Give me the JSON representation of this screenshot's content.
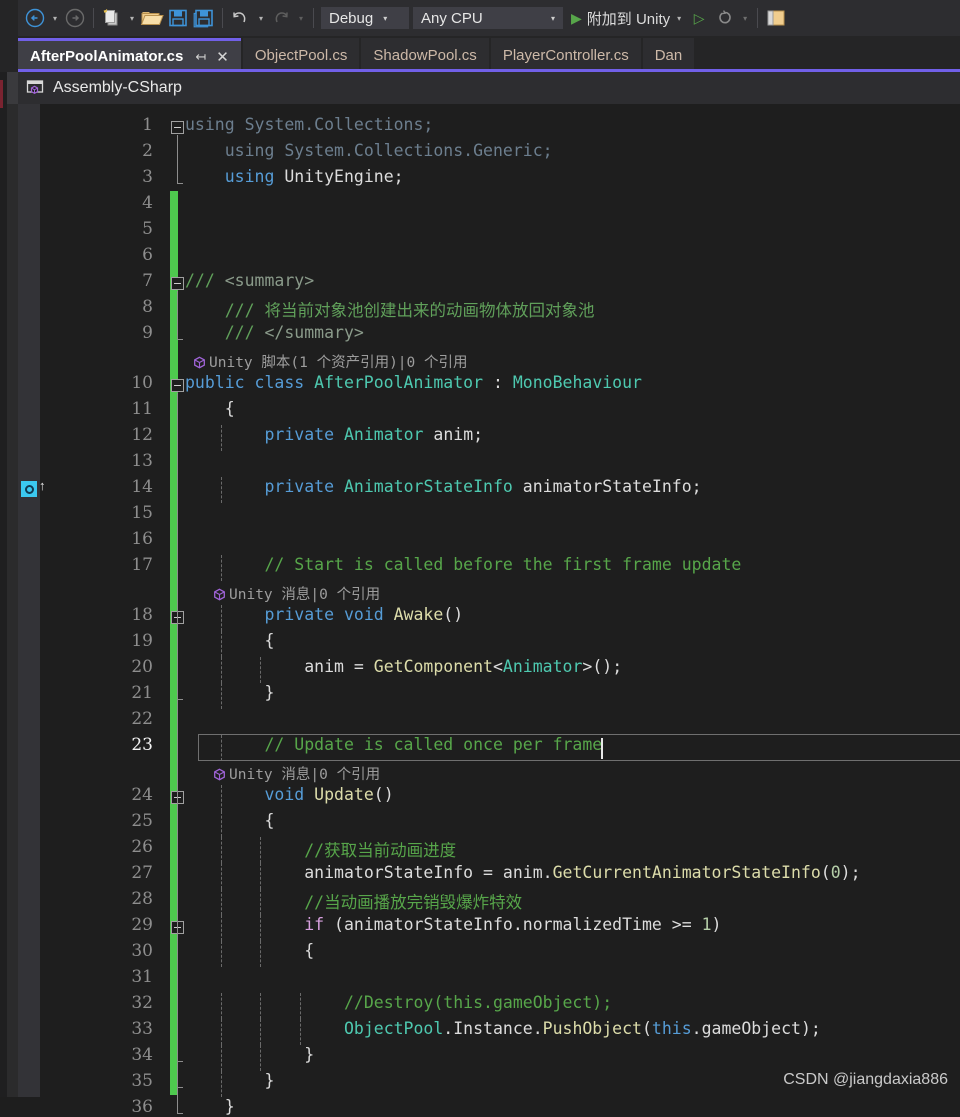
{
  "theme": {
    "bg": "#1e1e1e",
    "chrome": "#2d2d30",
    "accent_purple": "#7160e8",
    "change_bar_green": "#4ec94e",
    "keyword_blue": "#569cd6",
    "type_teal": "#4ec9b0",
    "comment_green": "#57a64a",
    "method_yellow": "#dcdcaa",
    "control_purple": "#d8a0df",
    "unity_marker_cyan": "#3bc9f0"
  },
  "toolbar": {
    "back_icon": "back-arrow-icon",
    "forward_icon": "forward-arrow-icon",
    "new_item_icon": "new-item-icon",
    "open_folder_icon": "open-folder-icon",
    "save_icon": "save-icon",
    "save_all_icon": "save-all-icon",
    "undo_icon": "undo-icon",
    "redo_icon": "redo-icon",
    "configuration": {
      "value": "Debug",
      "caret": "▾"
    },
    "platform": {
      "value": "Any CPU",
      "caret": "▾"
    },
    "run": {
      "play_glyph": "▶",
      "label": "附加到 Unity",
      "caret": "▾"
    },
    "run_alt_glyph": "▷",
    "hotreload_icon": "hot-reload-icon",
    "trailing_icon": "panel-icon"
  },
  "tabs": [
    {
      "label": "AfterPoolAnimator.cs",
      "active": true,
      "pin": "↤",
      "close": "✕"
    },
    {
      "label": "ObjectPool.cs",
      "active": false
    },
    {
      "label": "ShadowPool.cs",
      "active": false
    },
    {
      "label": "PlayerController.cs",
      "active": false
    },
    {
      "label": "Dan",
      "active": false
    }
  ],
  "breadcrumb": {
    "icon": "assembly-icon",
    "text": "Assembly-CSharp"
  },
  "editor": {
    "current_line": 23,
    "gutter_marker": {
      "icon": "unity-message-marker-icon",
      "arrow": "↑",
      "line": 10
    },
    "codelens": [
      {
        "after_line": 9,
        "icon": "unity-cube-icon",
        "text": "Unity 脚本(1 个资产引用)|0 个引用"
      },
      {
        "after_line": 17,
        "icon": "unity-cube-icon",
        "text": "Unity 消息|0 个引用"
      },
      {
        "after_line": 23,
        "icon": "unity-cube-icon",
        "text": "Unity 消息|0 个引用"
      }
    ],
    "lines": [
      {
        "n": 1,
        "fold": "open",
        "tokens": [
          {
            "c": "g",
            "s": "using System.Collections;"
          }
        ]
      },
      {
        "n": 2,
        "indent": 1,
        "tokens": [
          {
            "c": "g",
            "s": "using System.Collections.Generic;"
          }
        ]
      },
      {
        "n": 3,
        "indent": 1,
        "tokens": [
          {
            "c": "k",
            "s": "using "
          },
          {
            "c": "id",
            "s": "UnityEngine;"
          }
        ]
      },
      {
        "n": 4,
        "tokens": []
      },
      {
        "n": 5,
        "tokens": []
      },
      {
        "n": 6,
        "tokens": []
      },
      {
        "n": 7,
        "fold": "open",
        "tokens": [
          {
            "c": "cd",
            "s": "/// "
          },
          {
            "c": "cx",
            "s": "<summary>"
          }
        ]
      },
      {
        "n": 8,
        "indent": 1,
        "tokens": [
          {
            "c": "cd",
            "s": "/// 将当前对象池创建出来的动画物体放回对象池"
          }
        ]
      },
      {
        "n": 9,
        "indent": 1,
        "tokens": [
          {
            "c": "cd",
            "s": "/// "
          },
          {
            "c": "cx",
            "s": "</summary>"
          }
        ]
      },
      {
        "n": 10,
        "fold": "open",
        "tokens": [
          {
            "c": "k",
            "s": "public class "
          },
          {
            "c": "t",
            "s": "AfterPoolAnimator"
          },
          {
            "c": "p",
            "s": " : "
          },
          {
            "c": "t",
            "s": "MonoBehaviour"
          }
        ]
      },
      {
        "n": 11,
        "indent": 1,
        "tokens": [
          {
            "c": "p",
            "s": "{"
          }
        ]
      },
      {
        "n": 12,
        "indent": 2,
        "tokens": [
          {
            "c": "k",
            "s": "private "
          },
          {
            "c": "t",
            "s": "Animator"
          },
          {
            "c": "id",
            "s": " anim;"
          }
        ]
      },
      {
        "n": 13,
        "tokens": []
      },
      {
        "n": 14,
        "indent": 2,
        "tokens": [
          {
            "c": "k",
            "s": "private "
          },
          {
            "c": "t",
            "s": "AnimatorStateInfo"
          },
          {
            "c": "id",
            "s": " animatorStateInfo;"
          }
        ]
      },
      {
        "n": 15,
        "tokens": []
      },
      {
        "n": 16,
        "tokens": []
      },
      {
        "n": 17,
        "indent": 2,
        "tokens": [
          {
            "c": "c",
            "s": "// Start is called before the first frame update"
          }
        ]
      },
      {
        "n": 18,
        "fold": "open",
        "indent": 2,
        "tokens": [
          {
            "c": "k",
            "s": "private void "
          },
          {
            "c": "m",
            "s": "Awake"
          },
          {
            "c": "p",
            "s": "()"
          }
        ]
      },
      {
        "n": 19,
        "indent": 2,
        "tokens": [
          {
            "c": "p",
            "s": "{"
          }
        ]
      },
      {
        "n": 20,
        "indent": 3,
        "tokens": [
          {
            "c": "id",
            "s": "anim = "
          },
          {
            "c": "m",
            "s": "GetComponent"
          },
          {
            "c": "p",
            "s": "<"
          },
          {
            "c": "t",
            "s": "Animator"
          },
          {
            "c": "p",
            "s": ">();"
          }
        ]
      },
      {
        "n": 21,
        "indent": 2,
        "tokens": [
          {
            "c": "p",
            "s": "}"
          }
        ]
      },
      {
        "n": 22,
        "tokens": []
      },
      {
        "n": 23,
        "indent": 2,
        "current": true,
        "tokens": [
          {
            "c": "c",
            "s": "// Update is called once per frame"
          }
        ]
      },
      {
        "n": 24,
        "fold": "open",
        "indent": 2,
        "tokens": [
          {
            "c": "k",
            "s": "void "
          },
          {
            "c": "m",
            "s": "Update"
          },
          {
            "c": "p",
            "s": "()"
          }
        ]
      },
      {
        "n": 25,
        "indent": 2,
        "tokens": [
          {
            "c": "p",
            "s": "{"
          }
        ]
      },
      {
        "n": 26,
        "indent": 3,
        "tokens": [
          {
            "c": "c",
            "s": "//获取当前动画进度"
          }
        ]
      },
      {
        "n": 27,
        "indent": 3,
        "tokens": [
          {
            "c": "id",
            "s": "animatorStateInfo = anim."
          },
          {
            "c": "m",
            "s": "GetCurrentAnimatorStateInfo"
          },
          {
            "c": "p",
            "s": "("
          },
          {
            "c": "n",
            "s": "0"
          },
          {
            "c": "p",
            "s": ");"
          }
        ]
      },
      {
        "n": 28,
        "indent": 3,
        "tokens": [
          {
            "c": "c",
            "s": "//当动画播放完销毁爆炸特效"
          }
        ]
      },
      {
        "n": 29,
        "fold": "open",
        "indent": 3,
        "tokens": [
          {
            "c": "kc",
            "s": "if "
          },
          {
            "c": "p",
            "s": "("
          },
          {
            "c": "id",
            "s": "animatorStateInfo.normalizedTime "
          },
          {
            "c": "p",
            "s": ">= "
          },
          {
            "c": "n",
            "s": "1"
          },
          {
            "c": "p",
            "s": ")"
          }
        ]
      },
      {
        "n": 30,
        "indent": 3,
        "tokens": [
          {
            "c": "p",
            "s": "{"
          }
        ]
      },
      {
        "n": 31,
        "tokens": []
      },
      {
        "n": 32,
        "indent": 4,
        "tokens": [
          {
            "c": "c",
            "s": "//Destroy(this.gameObject);"
          }
        ]
      },
      {
        "n": 33,
        "indent": 4,
        "tokens": [
          {
            "c": "t",
            "s": "ObjectPool"
          },
          {
            "c": "id",
            "s": ".Instance."
          },
          {
            "c": "m",
            "s": "PushObject"
          },
          {
            "c": "p",
            "s": "("
          },
          {
            "c": "k",
            "s": "this"
          },
          {
            "c": "id",
            "s": ".gameObject"
          },
          {
            "c": "p",
            "s": ");"
          }
        ]
      },
      {
        "n": 34,
        "indent": 3,
        "tokens": [
          {
            "c": "p",
            "s": "}"
          }
        ]
      },
      {
        "n": 35,
        "indent": 2,
        "tokens": [
          {
            "c": "p",
            "s": "}"
          }
        ]
      },
      {
        "n": 36,
        "indent": 1,
        "tokens": [
          {
            "c": "p",
            "s": "}"
          }
        ]
      }
    ]
  },
  "watermark": "CSDN @jiangdaxia886"
}
